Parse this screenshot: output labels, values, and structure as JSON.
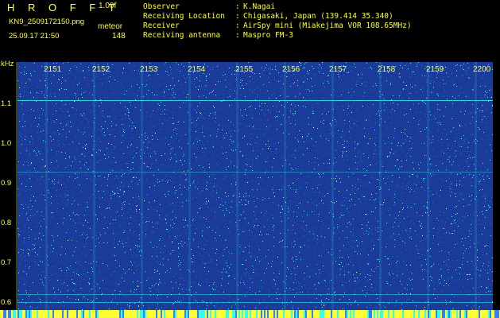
{
  "header": {
    "brand": "H R O F F T",
    "version": "1.00f",
    "file_name": "KN9_2509172150.png",
    "mode_label": "meteor",
    "datetime": "25.09.17 21:50",
    "count": "148",
    "info": [
      {
        "key": "Observer",
        "value": "K.Nagai"
      },
      {
        "key": "Receiving Location",
        "value": "Chigasaki, Japan (139.414 35.340)"
      },
      {
        "key": "Receiver",
        "value": "AirSpy mini (Miakejima VOR 108.65MHz)"
      },
      {
        "key": "Receiving antenna",
        "value": "Maspro FM-3"
      }
    ],
    "separator": ":"
  },
  "axes": {
    "y_unit": "kHz",
    "x_ticks": [
      "2151",
      "2152",
      "2153",
      "2154",
      "2155",
      "2156",
      "2157",
      "2158",
      "2159",
      "2200"
    ],
    "y_ticks": [
      "1.1",
      "1.0",
      "0.9",
      "0.8",
      "0.7",
      "0.6"
    ]
  },
  "colors": {
    "text": "#ffff33",
    "background": "#000000",
    "plot_base": "#1b3b9a",
    "noise_hot": "#33ffee",
    "noise_mid": "#2a70c8",
    "noise_warm": "#ffff66"
  }
}
